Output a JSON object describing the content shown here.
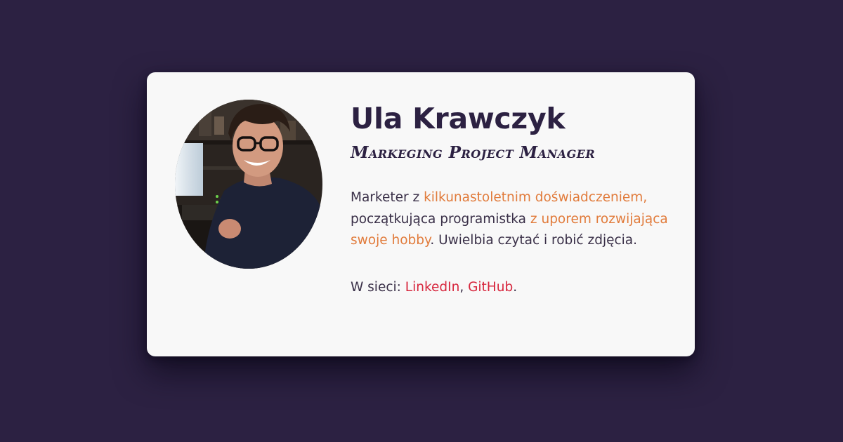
{
  "profile": {
    "name": "Ula Krawczyk",
    "role": "Markeging Project Manager",
    "photo_alt": "profile-photo"
  },
  "bio": {
    "part1": "Marketer z ",
    "highlight1": "kilkunastoletnim doświadczeniem,",
    "part2": " początkująca programistka ",
    "highlight2": "z uporem rozwijająca swoje hobby",
    "part3": ". Uwielbia czytać i robić zdjęcia."
  },
  "social": {
    "prefix": "W sieci: ",
    "links": [
      {
        "label": "LinkedIn"
      },
      {
        "label": "GitHub"
      }
    ],
    "separator": ", ",
    "suffix": "."
  },
  "colors": {
    "background": "#2c2142",
    "card": "#f8f8f8",
    "heading": "#2c2142",
    "accent_orange": "#e17b3b",
    "link_red": "#d7263d"
  }
}
